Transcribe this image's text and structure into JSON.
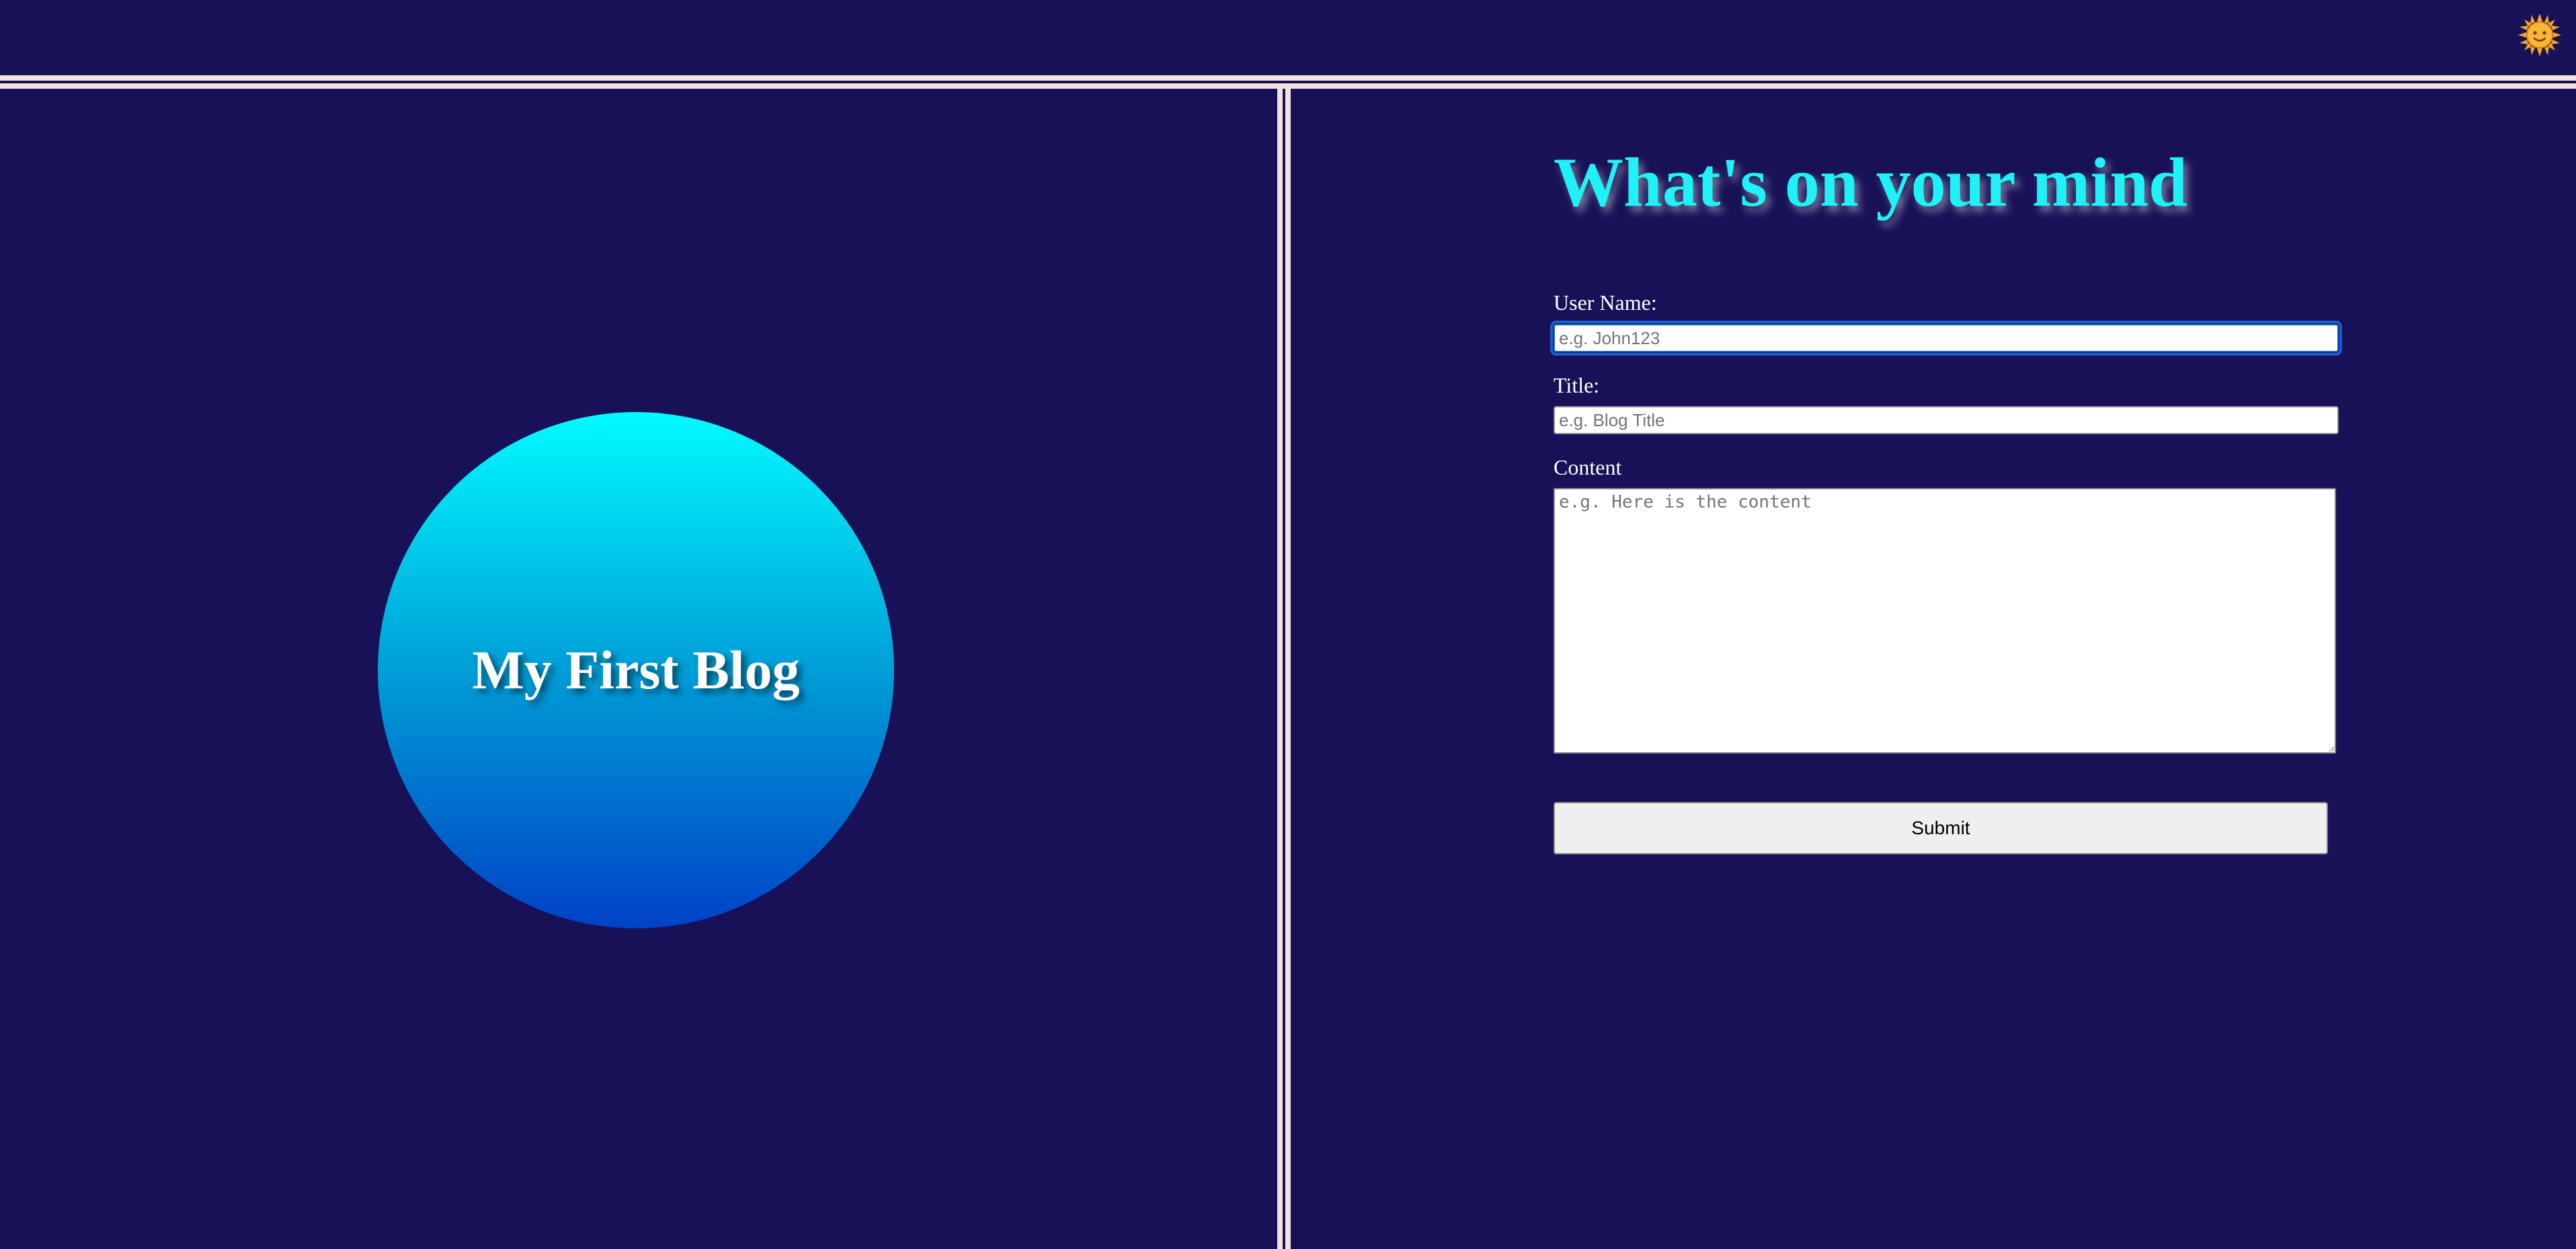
{
  "header": {
    "theme_toggle_icon": "sun-icon"
  },
  "hero": {
    "title": "My First Blog"
  },
  "form": {
    "heading": "What's on your mind",
    "username": {
      "label": "User Name:",
      "value": "",
      "placeholder": "e.g. John123"
    },
    "title": {
      "label": "Title:",
      "value": "",
      "placeholder": "e.g. Blog Title"
    },
    "content": {
      "label": "Content",
      "value": "",
      "placeholder": "e.g. Here is the content"
    },
    "submit_label": "Submit"
  },
  "colors": {
    "background": "#181157",
    "divider": "#f3e3de",
    "heading": "#1ff2f6",
    "circle_top": "#00fbff",
    "circle_bottom": "#0042c6"
  }
}
